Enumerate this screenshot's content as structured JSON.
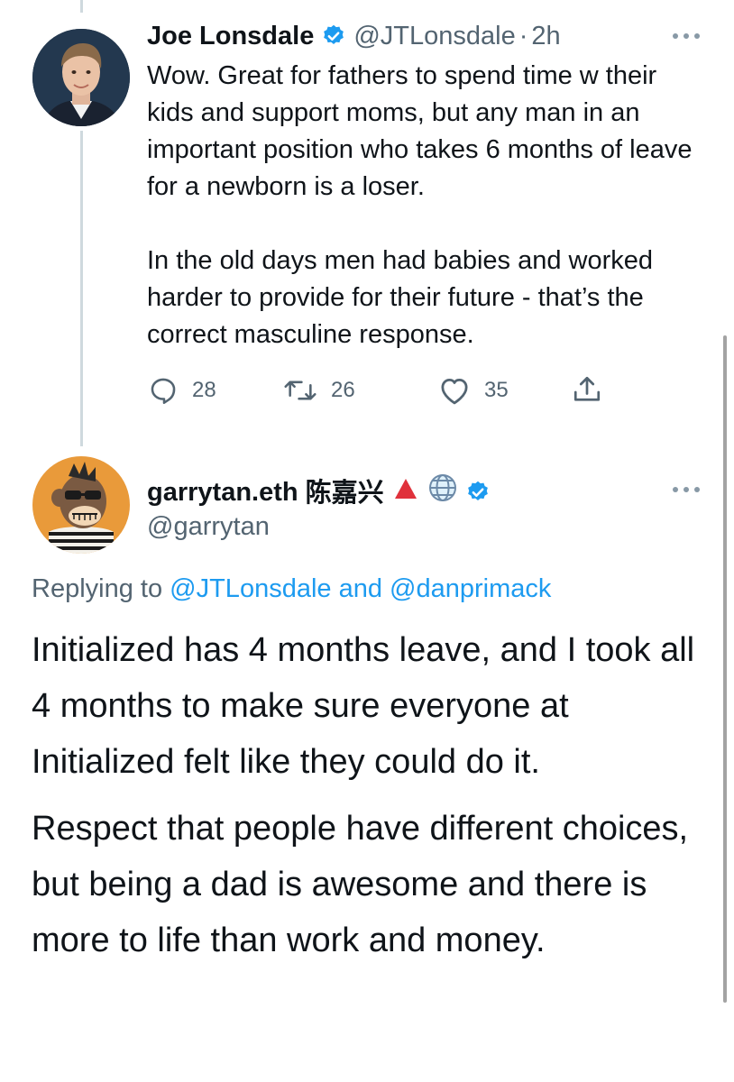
{
  "tweet1": {
    "name": "Joe Lonsdale",
    "handle": "@JTLonsdale",
    "separator": "·",
    "time": "2h",
    "paragraphs": [
      "Wow.  Great for fathers to spend time w their kids and support moms, but any man in an important position who takes 6 months of leave for a newborn is a loser.",
      "In the old days men had babies and worked harder to provide for their future - that’s the correct masculine response."
    ],
    "reply_count": "28",
    "retweet_count": "26",
    "like_count": "35"
  },
  "tweet2": {
    "name": "garrytan.eth",
    "name_cjk": "陈嘉兴",
    "name_emoji": [
      "red-triangle",
      "globe"
    ],
    "handle": "@garrytan",
    "replying_prefix": "Replying to",
    "replying_user1": "@JTLonsdale",
    "replying_and": "and",
    "replying_user2": "@danprimack",
    "paragraphs": [
      "Initialized has 4 months leave, and I took all 4 months to make sure everyone at Initialized felt like they could do it.",
      "Respect that people have different choices, but being a dad is awesome and there is more to life than work and money."
    ]
  },
  "colors": {
    "text": "#0f1419",
    "secondary": "#536471",
    "link": "#1d9bf0",
    "verified": "#1d9bf0",
    "thread_line": "#cfd9de"
  }
}
